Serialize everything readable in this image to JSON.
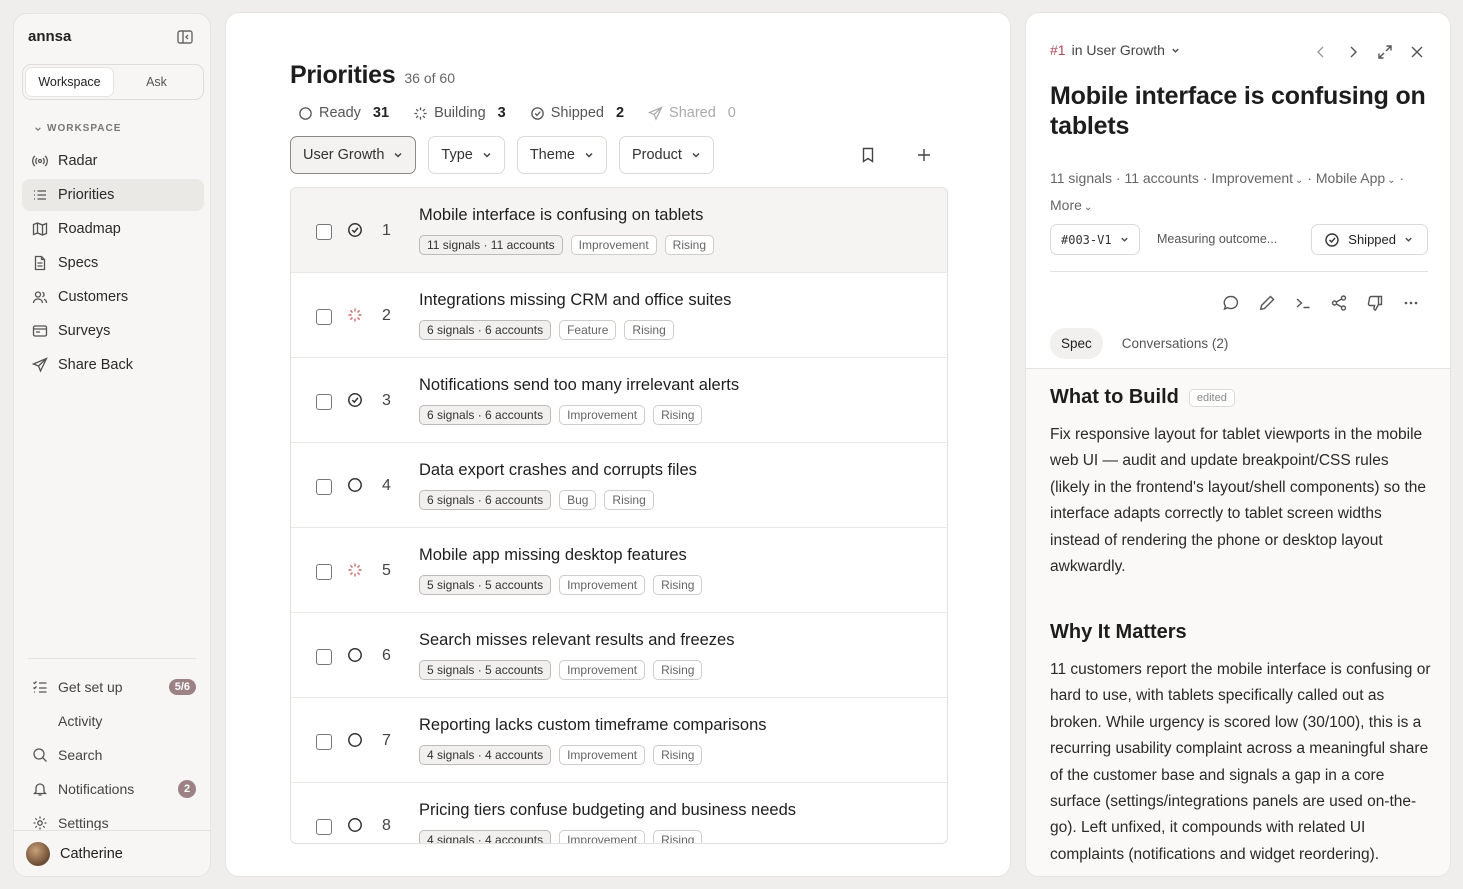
{
  "sidebar": {
    "brand": "annsa",
    "tabs": [
      "Workspace",
      "Ask"
    ],
    "section_label": "WORKSPACE",
    "nav": [
      {
        "label": "Radar",
        "icon": "radar-icon"
      },
      {
        "label": "Priorities",
        "icon": "list-icon"
      },
      {
        "label": "Roadmap",
        "icon": "map-icon"
      },
      {
        "label": "Specs",
        "icon": "document-icon"
      },
      {
        "label": "Customers",
        "icon": "users-icon"
      },
      {
        "label": "Surveys",
        "icon": "survey-icon"
      },
      {
        "label": "Share Back",
        "icon": "send-icon"
      }
    ],
    "bottom": [
      {
        "label": "Get set up",
        "badge": "5/6",
        "icon": "checklist-icon"
      },
      {
        "label": "Activity",
        "icon": "dot-icon"
      },
      {
        "label": "Search",
        "icon": "search-icon"
      },
      {
        "label": "Notifications",
        "badge": "2",
        "icon": "bell-icon"
      },
      {
        "label": "Settings",
        "icon": "gear-icon"
      }
    ],
    "user": "Catherine"
  },
  "main": {
    "title": "Priorities",
    "count": "36 of 60",
    "statuses": [
      {
        "label": "Ready",
        "count": "31"
      },
      {
        "label": "Building",
        "count": "3"
      },
      {
        "label": "Shipped",
        "count": "2"
      },
      {
        "label": "Shared",
        "count": "0"
      }
    ],
    "filters": [
      "User Growth",
      "Type",
      "Theme",
      "Product"
    ],
    "rows": [
      {
        "num": "1",
        "title": "Mobile interface is confusing on tablets",
        "meta": "11 signals · 11 accounts",
        "type": "Improvement",
        "trend": "Rising",
        "status": "shipped"
      },
      {
        "num": "2",
        "title": "Integrations missing CRM and office suites",
        "meta": "6 signals · 6 accounts",
        "type": "Feature",
        "trend": "Rising",
        "status": "building"
      },
      {
        "num": "3",
        "title": "Notifications send too many irrelevant alerts",
        "meta": "6 signals · 6 accounts",
        "type": "Improvement",
        "trend": "Rising",
        "status": "shipped"
      },
      {
        "num": "4",
        "title": "Data export crashes and corrupts files",
        "meta": "6 signals · 6 accounts",
        "type": "Bug",
        "trend": "Rising",
        "status": "ready"
      },
      {
        "num": "5",
        "title": "Mobile app missing desktop features",
        "meta": "5 signals · 5 accounts",
        "type": "Improvement",
        "trend": "Rising",
        "status": "building"
      },
      {
        "num": "6",
        "title": "Search misses relevant results and freezes",
        "meta": "5 signals · 5 accounts",
        "type": "Improvement",
        "trend": "Rising",
        "status": "ready"
      },
      {
        "num": "7",
        "title": "Reporting lacks custom timeframe comparisons",
        "meta": "4 signals · 4 accounts",
        "type": "Improvement",
        "trend": "Rising",
        "status": "ready"
      },
      {
        "num": "8",
        "title": "Pricing tiers confuse budgeting and business needs",
        "meta": "4 signals · 4 accounts",
        "type": "Improvement",
        "trend": "Rising",
        "status": "ready"
      }
    ]
  },
  "detail": {
    "id": "#1",
    "context": "in User Growth",
    "title": "Mobile interface is confusing on tablets",
    "meta_signals": "11 signals · 11 accounts ·",
    "meta_type": "Improvement",
    "meta_product": "Mobile App",
    "meta_more": "More",
    "version": "#003-V1",
    "outcome": "Measuring outcome...",
    "status": "Shipped",
    "tabs": [
      "Spec",
      "Conversations (2)"
    ],
    "what_title": "What to Build",
    "edited": "edited",
    "what_body": "Fix responsive layout for tablet viewports in the mobile web UI — audit and update breakpoint/CSS rules (likely in the frontend's layout/shell components) so the interface adapts correctly to tablet screen widths instead of rendering the phone or desktop layout awkwardly.",
    "why_title": "Why It Matters",
    "why_body": "11 customers report the mobile interface is confusing or hard to use, with tablets specifically called out as broken. While urgency is scored low (30/100), this is a recurring usability complaint across a meaningful share of the customer base and signals a gap in a core surface (settings/integrations panels are used on-the-go). Left unfixed, it compounds with related UI complaints (notifications and widget reordering)."
  },
  "colors": {
    "accent_id": "#b0495a",
    "badge": "#9c8185"
  }
}
